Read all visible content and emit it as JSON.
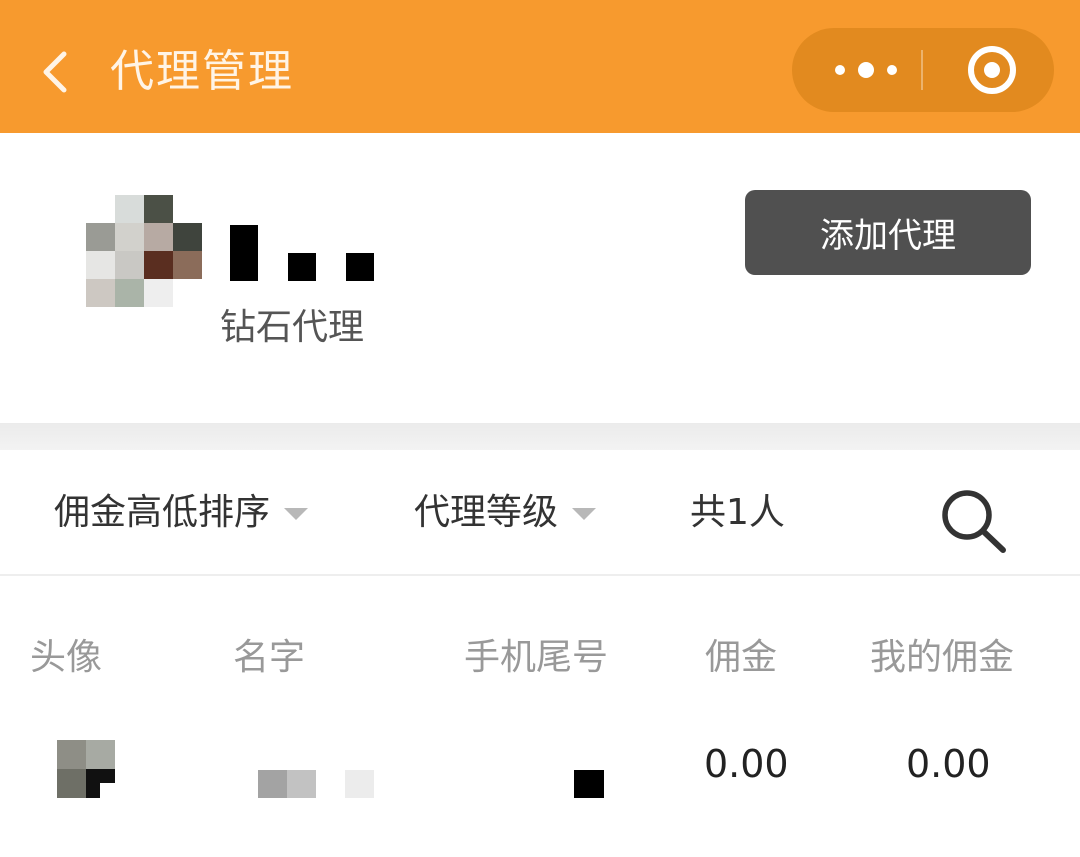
{
  "header": {
    "title": "代理管理",
    "back_icon": "chevron-left-icon",
    "more_icon": "more-dots-icon",
    "close_icon": "target-circle-icon",
    "bg_color": "#f79a2e"
  },
  "profile": {
    "level": "钻石代理",
    "add_button": "添加代理"
  },
  "filters": {
    "sort_label": "佣金高低排序",
    "level_label": "代理等级",
    "count_text": "共1人",
    "search_icon": "search-icon"
  },
  "table": {
    "headers": [
      "头像",
      "名字",
      "手机尾号",
      "佣金",
      "我的佣金"
    ],
    "rows": [
      {
        "commission": "0.00",
        "my_commission": "0.00"
      }
    ]
  }
}
